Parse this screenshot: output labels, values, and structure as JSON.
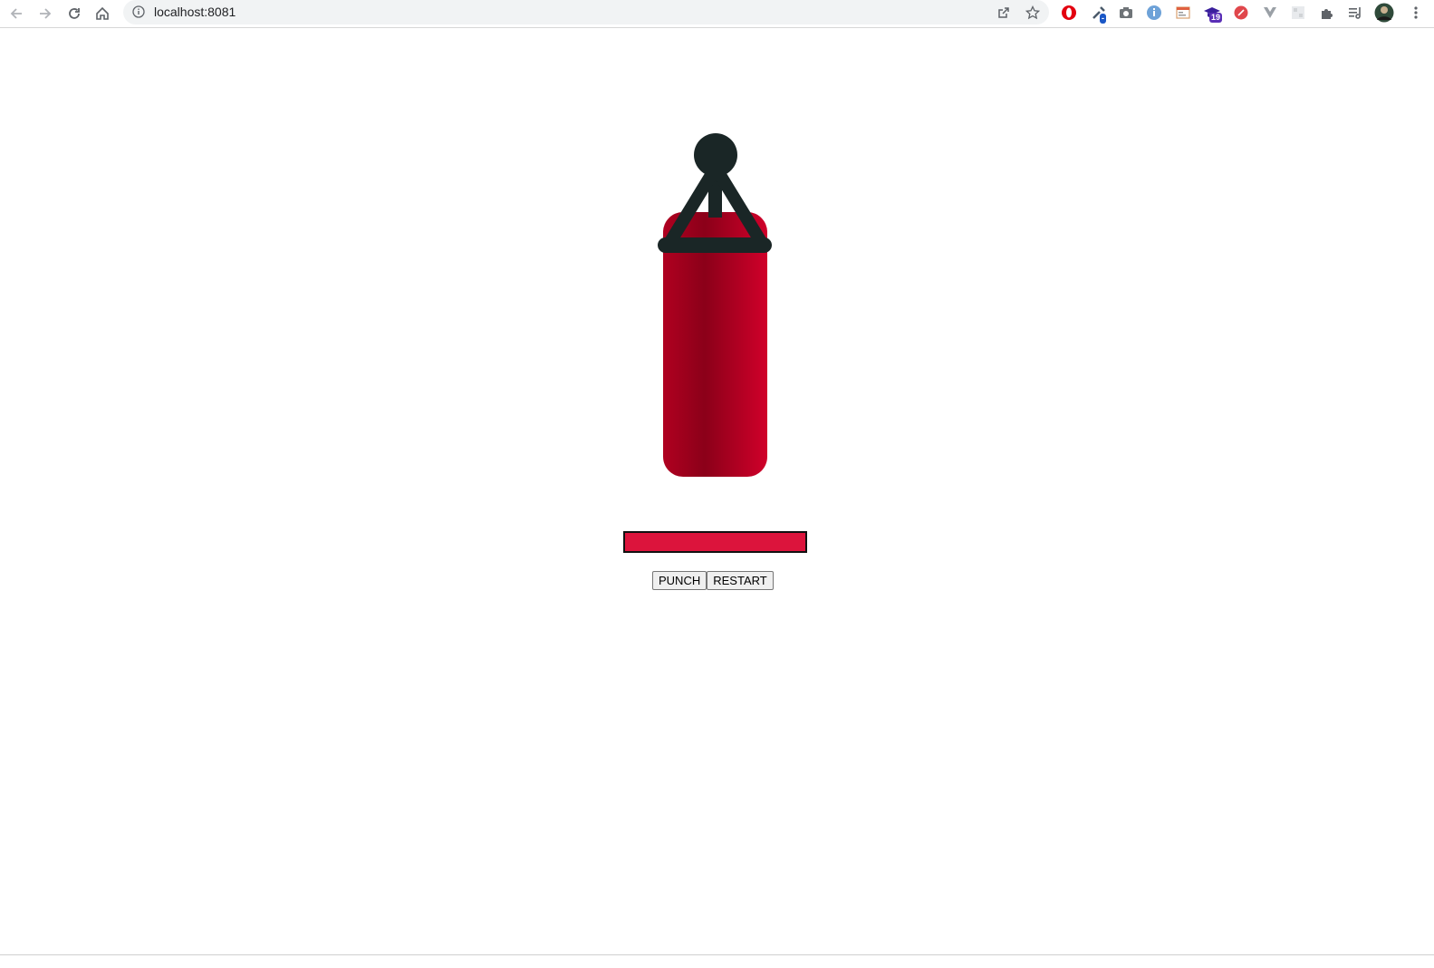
{
  "browser": {
    "url": "localhost:8081",
    "extension_badges": {
      "extension_19": "19"
    }
  },
  "game": {
    "health_level": 1.0,
    "colors": {
      "bag_dark": "#8b0019",
      "bag_light": "#d0002a",
      "strap": "#1a2626",
      "health_fill": "#dc143c",
      "health_border": "#111111"
    }
  },
  "controls": {
    "punch_label": "PUNCH",
    "restart_label": "RESTART"
  }
}
